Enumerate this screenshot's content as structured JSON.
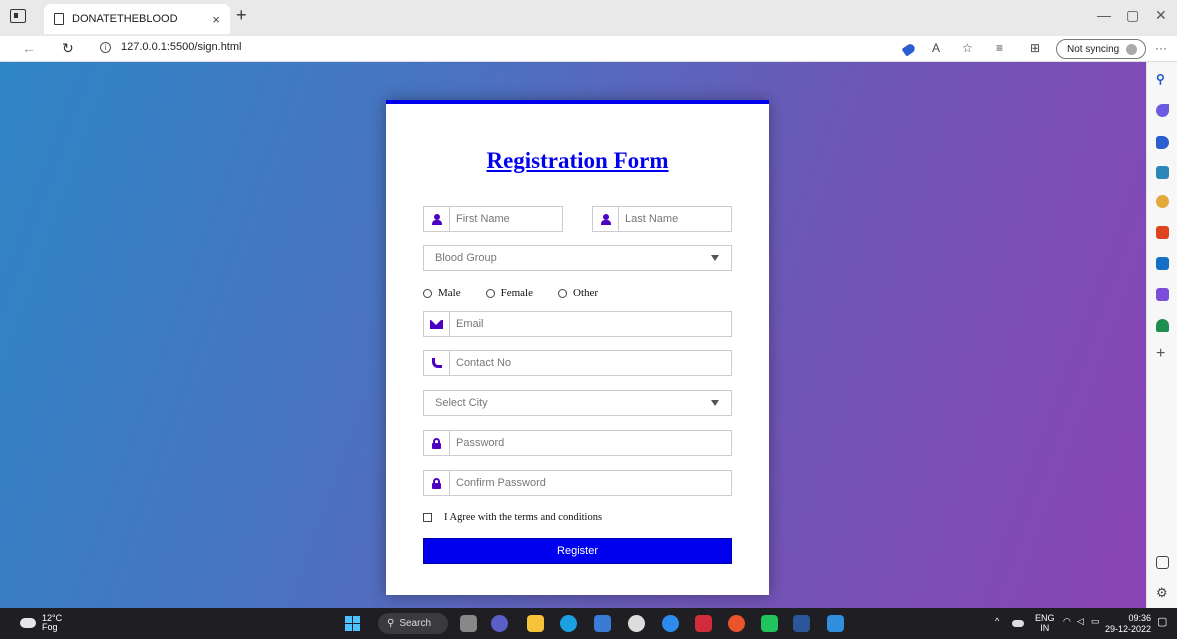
{
  "browser": {
    "tab_title": "DONATETHEBLOOD",
    "tab_close": "×",
    "new_tab": "+",
    "url": "127.0.0.1:5500/sign.html",
    "sync_label": "Not syncing",
    "icons": [
      "tab-actions-icon",
      "page-icon",
      "back-icon",
      "refresh-icon",
      "info-icon",
      "tag-icon",
      "read-aloud-icon",
      "favorite-icon",
      "favorites-icon",
      "collections-icon",
      "profile-icon",
      "more-icon"
    ]
  },
  "form": {
    "title": "Registration Form",
    "first_name_placeholder": "First Name",
    "last_name_placeholder": "Last Name",
    "blood_group_placeholder": "Blood Group",
    "gender_options": [
      "Male",
      "Female",
      "Other"
    ],
    "email_placeholder": "Email",
    "contact_placeholder": "Contact No",
    "city_placeholder": "Select City",
    "password_placeholder": "Password",
    "confirm_password_placeholder": "Confirm Password",
    "agree_label": "I Agree with the terms and conditions",
    "register_label": "Register"
  },
  "sidebar": {
    "items": [
      "search-icon",
      "copilot-icon",
      "shopping-icon",
      "tools-icon",
      "games-icon",
      "office-icon",
      "outlook-icon",
      "drop-icon",
      "tree-icon",
      "add-icon",
      "split-screen-icon",
      "settings-icon"
    ],
    "add_label": "+"
  },
  "taskbar": {
    "weather_temp": "12°C",
    "weather_desc": "Fog",
    "search_label": "Search",
    "lang_top": "ENG",
    "lang_bottom": "IN",
    "time": "09:36",
    "date": "29-12-2022"
  },
  "colors": {
    "accent": "#0000ee",
    "icon": "#4b00c2",
    "bg_start": "#2f86c6",
    "bg_end": "#8a44b4"
  }
}
